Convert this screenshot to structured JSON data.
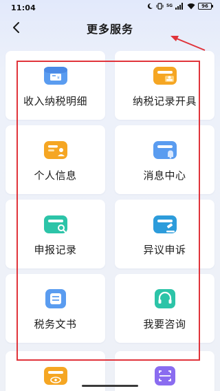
{
  "status_bar": {
    "time": "11:04",
    "network_label": "5G",
    "battery_level": "96"
  },
  "header": {
    "back_icon": "chevron-left-icon",
    "title": "更多服务"
  },
  "services": [
    {
      "label": "收入纳税明细",
      "icon": "income-card-icon",
      "color": "#5a9cf0"
    },
    {
      "label": "纳税记录开具",
      "icon": "certificate-card-icon",
      "color": "#f5a623"
    },
    {
      "label": "个人信息",
      "icon": "id-card-icon",
      "color": "#f5a623"
    },
    {
      "label": "消息中心",
      "icon": "message-bell-icon",
      "color": "#5a9cf0"
    },
    {
      "label": "申报记录",
      "icon": "record-search-icon",
      "color": "#2cc4a8"
    },
    {
      "label": "异议申诉",
      "icon": "gavel-folder-icon",
      "color": "#2d9cdb"
    },
    {
      "label": "税务文书",
      "icon": "document-icon",
      "color": "#5a9cf0"
    },
    {
      "label": "我要咨询",
      "icon": "headset-icon",
      "color": "#2cc4a8"
    }
  ],
  "partial_services": [
    {
      "icon": "eye-card-icon",
      "color": "#f5a623"
    },
    {
      "icon": "scan-icon",
      "color": "#8a6cf0"
    }
  ],
  "annotation": {
    "color": "#e0333a"
  }
}
